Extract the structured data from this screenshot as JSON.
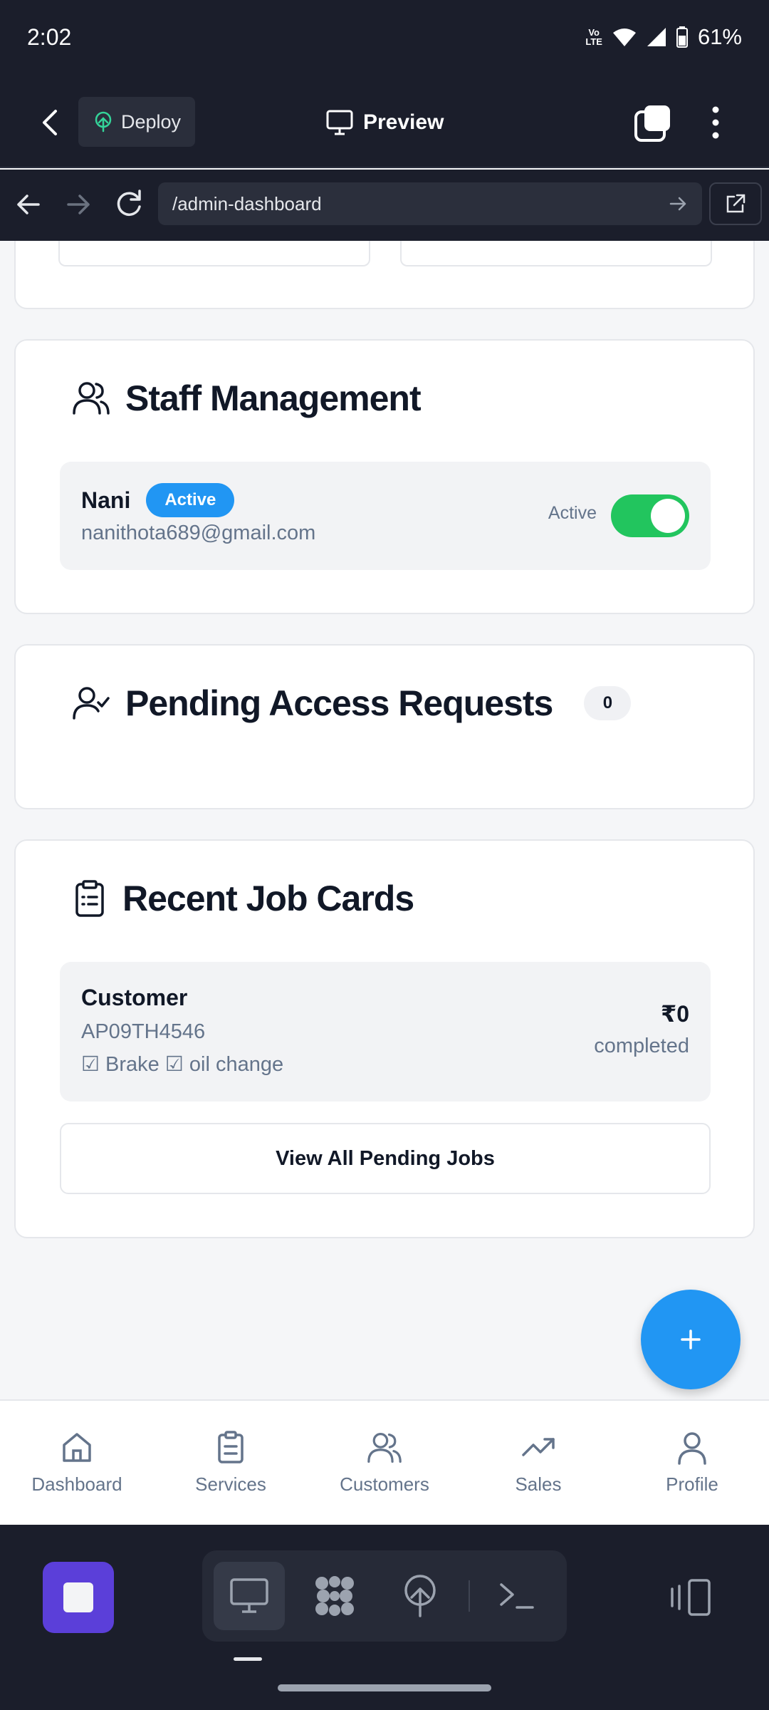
{
  "status_bar": {
    "time": "2:02",
    "network": "Vo LTE",
    "battery": "61%"
  },
  "toolbar": {
    "deploy_label": "Deploy",
    "preview_label": "Preview"
  },
  "browser": {
    "url": "/admin-dashboard"
  },
  "staff_section": {
    "title": "Staff Management",
    "staff": [
      {
        "name": "Nani",
        "badge": "Active",
        "email": "nanithota689@gmail.com",
        "toggle_label": "Active",
        "toggle_on": true
      }
    ]
  },
  "requests_section": {
    "title": "Pending Access Requests",
    "count": "0"
  },
  "jobs_section": {
    "title": "Recent Job Cards",
    "jobs": [
      {
        "customer": "Customer",
        "vehicle": "AP09TH4546",
        "services": "☑ Brake ☑ oil change",
        "amount": "₹0",
        "status": "completed"
      }
    ],
    "view_all_label": "View All Pending Jobs"
  },
  "fab_icon": "plus-icon",
  "bottom_nav": [
    {
      "label": "Dashboard",
      "icon": "home-icon"
    },
    {
      "label": "Services",
      "icon": "clipboard-icon"
    },
    {
      "label": "Customers",
      "icon": "users-icon"
    },
    {
      "label": "Sales",
      "icon": "trending-up-icon"
    },
    {
      "label": "Profile",
      "icon": "user-icon"
    }
  ],
  "colors": {
    "accent": "#2196f3",
    "toggle_on": "#22c55e",
    "dark_bg": "#1b1e2b",
    "stop_button": "#5b3fd9"
  }
}
